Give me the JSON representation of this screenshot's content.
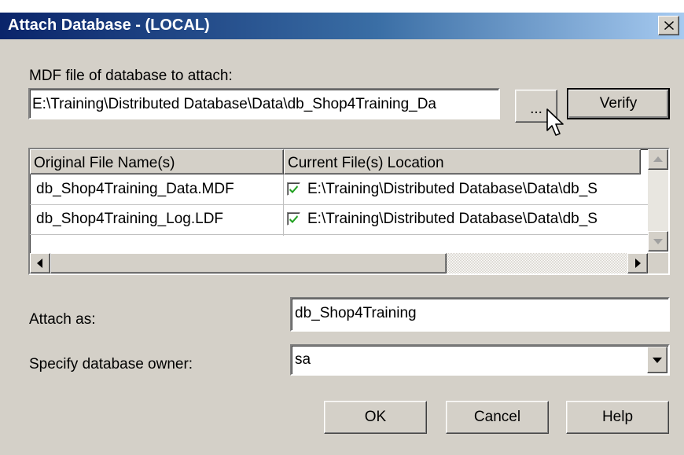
{
  "window": {
    "title": "Attach Database - (LOCAL)"
  },
  "mdf": {
    "label": "MDF file of database to attach:",
    "value": "E:\\Training\\Distributed Database\\Data\\db_Shop4Training_Da",
    "browse_label": "...",
    "verify_label": "Verify"
  },
  "files": {
    "headers": [
      "Original File Name(s)",
      "Current File(s) Location"
    ],
    "rows": [
      {
        "name": "db_Shop4Training_Data.MDF",
        "checked": true,
        "location": "E:\\Training\\Distributed Database\\Data\\db_S"
      },
      {
        "name": "db_Shop4Training_Log.LDF",
        "checked": true,
        "location": "E:\\Training\\Distributed Database\\Data\\db_S"
      }
    ]
  },
  "attach_as": {
    "label": "Attach as:",
    "value": "db_Shop4Training"
  },
  "owner": {
    "label": "Specify database owner:",
    "value": "sa"
  },
  "buttons": {
    "ok": "OK",
    "cancel": "Cancel",
    "help": "Help"
  },
  "icons": {
    "close": "close-icon",
    "check": "checkmark-icon",
    "cursor": "mouse-pointer-icon",
    "dropdown": "chevron-down-icon"
  },
  "colors": {
    "titlebar_start": "#0a246a",
    "titlebar_end": "#a6caf0",
    "face": "#d4d0c8",
    "check": "#21a121"
  }
}
